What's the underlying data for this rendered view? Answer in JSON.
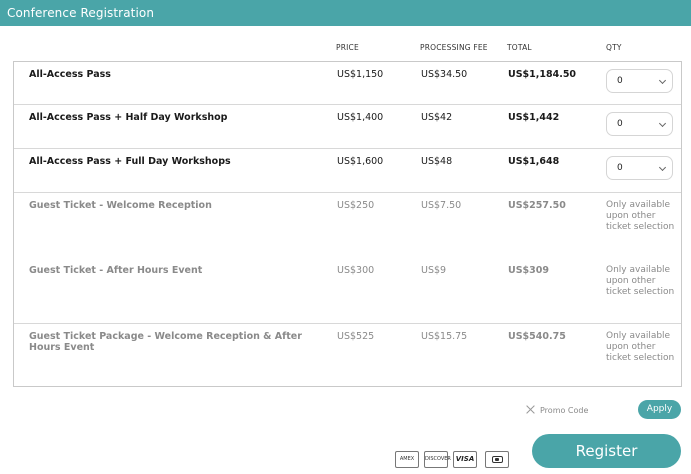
{
  "header": {
    "title": "Conference Registration"
  },
  "columns": {
    "price": "PRICE",
    "fee": "PROCESSING FEE",
    "total": "TOTAL",
    "qty": "QTY"
  },
  "tickets": [
    {
      "name": "All-Access Pass",
      "price": "US$1,150",
      "fee": "US$34.50",
      "total": "US$1,184.50",
      "qty": "0"
    },
    {
      "name": "All-Access Pass + Half Day Workshop",
      "price": "US$1,400",
      "fee": "US$42",
      "total": "US$1,442",
      "qty": "0"
    },
    {
      "name": "All-Access Pass + Full Day Workshops",
      "price": "US$1,600",
      "fee": "US$48",
      "total": "US$1,648",
      "qty": "0"
    },
    {
      "name": "Guest Ticket - Welcome Reception",
      "price": "US$250",
      "fee": "US$7.50",
      "total": "US$257.50",
      "note": "Only available upon other ticket selection"
    },
    {
      "name": "Guest Ticket - After Hours Event",
      "price": "US$300",
      "fee": "US$9",
      "total": "US$309",
      "note": "Only available upon other ticket selection"
    },
    {
      "name": "Guest Ticket Package - Welcome Reception & After Hours Event",
      "price": "US$525",
      "fee": "US$15.75",
      "total": "US$540.75",
      "note": "Only available upon other ticket selection"
    }
  ],
  "promo": {
    "label": "Promo Code",
    "apply": "Apply"
  },
  "cards": {
    "amex": "AMEX",
    "discover": "DISCOVER",
    "visa": "VISA"
  },
  "register": "Register",
  "colors": {
    "accent": "#4aa5a8"
  }
}
